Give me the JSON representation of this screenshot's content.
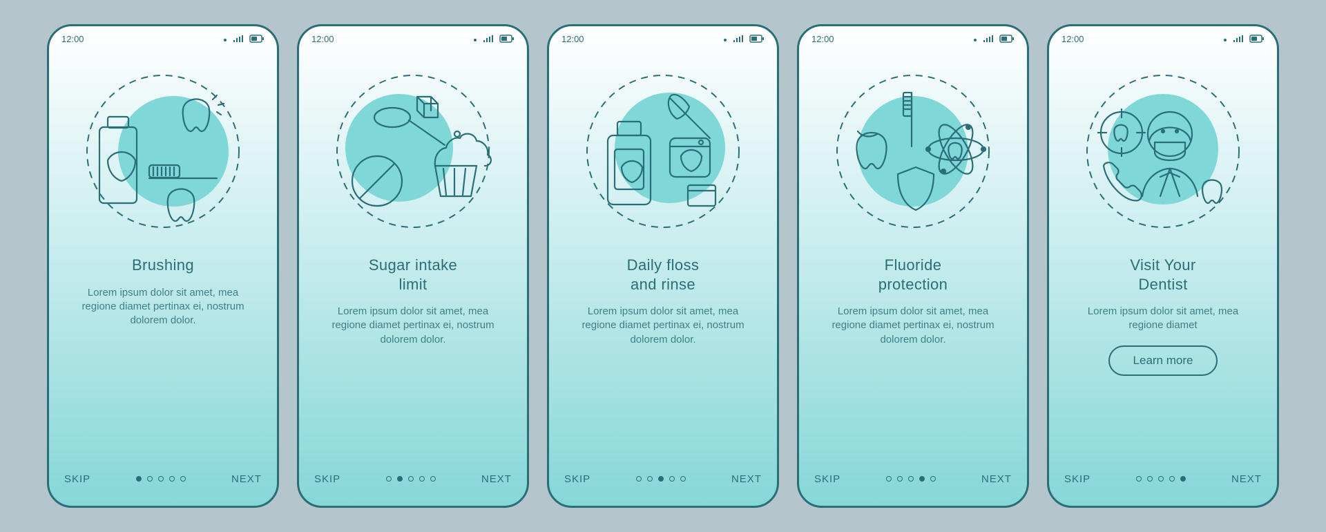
{
  "status": {
    "time": "12:00"
  },
  "nav": {
    "skip": "SKIP",
    "next": "NEXT",
    "cta": "Learn more"
  },
  "pagination": {
    "total": 5
  },
  "screens": [
    {
      "title": "Brushing",
      "body": "Lorem ipsum dolor sit amet, mea regione diamet pertinax ei, nostrum dolorem dolor.",
      "active_dot": 0
    },
    {
      "title": "Sugar intake\nlimit",
      "body": "Lorem ipsum dolor sit amet, mea regione diamet pertinax ei, nostrum dolorem dolor.",
      "active_dot": 1
    },
    {
      "title": "Daily floss\nand rinse",
      "body": "Lorem ipsum dolor sit amet, mea regione diamet pertinax ei, nostrum dolorem dolor.",
      "active_dot": 2
    },
    {
      "title": "Fluoride\nprotection",
      "body": "Lorem ipsum dolor sit amet, mea regione diamet pertinax ei, nostrum dolorem dolor.",
      "active_dot": 3
    },
    {
      "title": "Visit Your\nDentist",
      "body": "Lorem ipsum dolor sit amet, mea regione diamet",
      "active_dot": 4,
      "cta": true
    }
  ]
}
